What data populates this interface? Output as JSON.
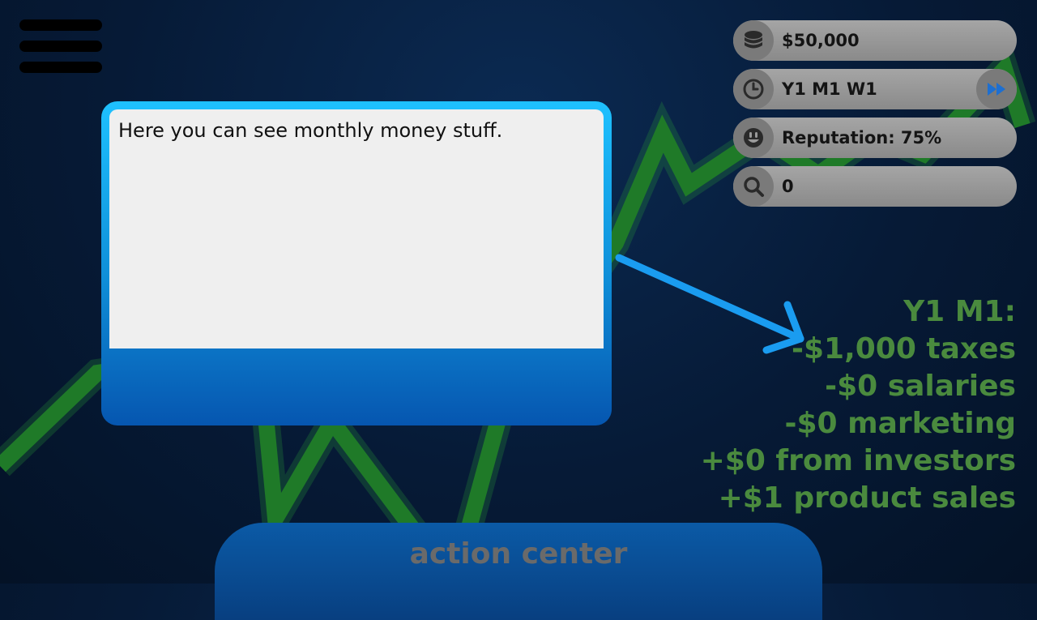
{
  "hud": {
    "money": "$50,000",
    "date": "Y1 M1 W1",
    "reputation": "Reputation: 75%",
    "search_count": "0"
  },
  "tutorial": {
    "message": "Here you can see monthly money stuff."
  },
  "monthly_report": {
    "header": "Y1 M1:",
    "lines": [
      "-$1,000 taxes",
      "-$0 salaries",
      "-$0 marketing",
      "+$0 from investors",
      "+$1 product sales"
    ]
  },
  "action_center": {
    "label": "action center"
  },
  "icons": {
    "menu": "hamburger-menu-icon",
    "money": "coin-stack-icon",
    "date": "clock-icon",
    "fast_forward": "fast-forward-icon",
    "reputation": "smiley-face-icon",
    "search": "magnifier-icon",
    "pointer": "arrow-icon"
  },
  "colors": {
    "background": "#061a36",
    "chart_line": "#2a8a2e",
    "report_text": "#4a8a3e",
    "dialog_border": "#1ec1ff",
    "pill": "#9a9a9a",
    "arrow": "#1a9cf0"
  }
}
